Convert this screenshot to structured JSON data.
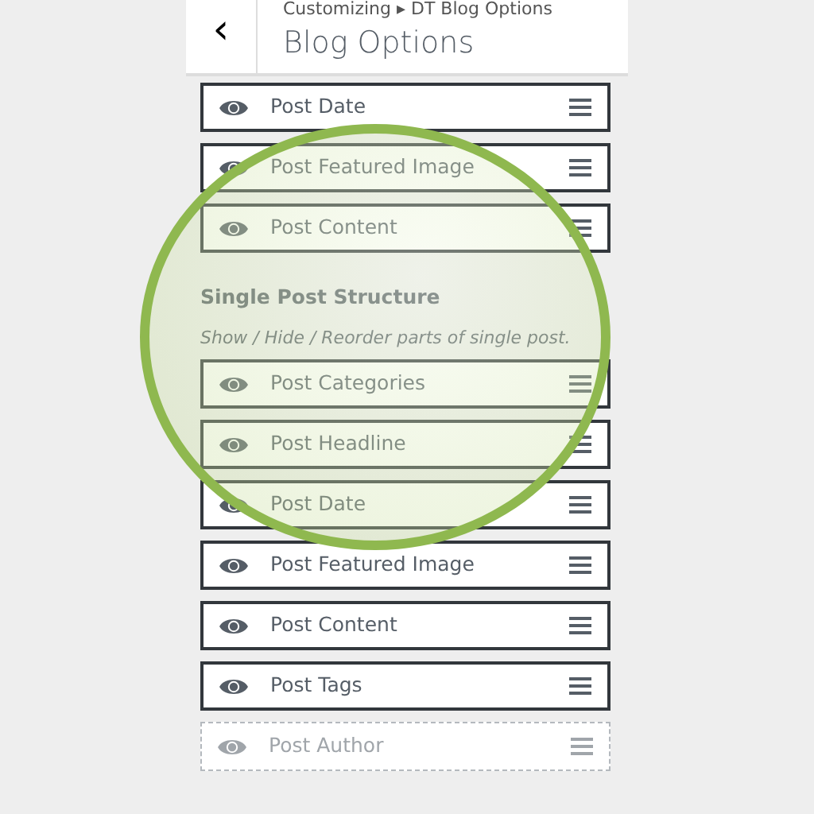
{
  "header": {
    "breadcrumb": "Customizing ▸ DT Blog Options",
    "title": "Blog Options",
    "back": "‹"
  },
  "blog_items": [
    {
      "label": "Post Date",
      "visible": true
    },
    {
      "label": "Post Featured Image",
      "visible": true
    },
    {
      "label": "Post Content",
      "visible": true
    }
  ],
  "single_post": {
    "title": "Single Post Structure",
    "description": "Show / Hide / Reorder parts of single post.",
    "items": [
      {
        "label": "Post Categories",
        "visible": true
      },
      {
        "label": "Post Headline",
        "visible": true
      },
      {
        "label": "Post Date",
        "visible": true
      },
      {
        "label": "Post Featured Image",
        "visible": true
      },
      {
        "label": "Post Content",
        "visible": true
      },
      {
        "label": "Post Tags",
        "visible": true
      },
      {
        "label": "Post Author",
        "visible": false
      }
    ]
  }
}
